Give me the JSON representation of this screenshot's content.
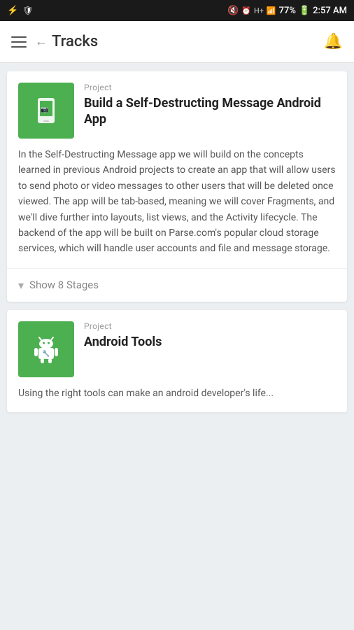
{
  "status_bar": {
    "time": "2:57 AM",
    "battery": "77%",
    "signal": "H+"
  },
  "nav": {
    "back_label": "Tracks",
    "bell_label": "notifications"
  },
  "cards": [
    {
      "id": "card-1",
      "label": "Project",
      "title": "Build a Self-Destructing Message Android App",
      "description": "In the Self-Destructing Message app we will build on the concepts learned in previous Android projects to create an app that will allow users to send photo or video messages to other users that will be deleted once viewed. The app will be tab-based, meaning we will cover Fragments, and we'll dive further into layouts, list views, and the Activity lifecycle. The backend of the app will be built on Parse.com's popular cloud storage services, which will handle user accounts and file and message storage.",
      "stages_count": "8",
      "show_stages_label": "Show 8 Stages",
      "icon_type": "phone"
    },
    {
      "id": "card-2",
      "label": "Project",
      "title": "Android Tools",
      "description": "Using the right tools can make an android developer's life...",
      "icon_type": "android"
    }
  ]
}
